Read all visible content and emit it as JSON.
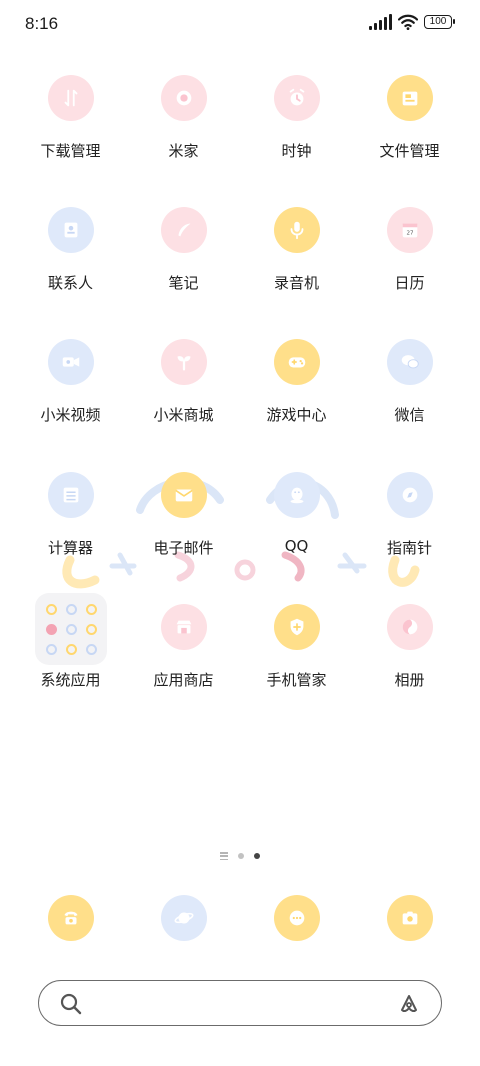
{
  "status_bar": {
    "time": "8:16",
    "battery": "100"
  },
  "apps": [
    {
      "label": "下载管理",
      "icon": "download-arrows-icon",
      "color": "#fde0e4"
    },
    {
      "label": "米家",
      "icon": "mijia-icon",
      "color": "#fde0e4"
    },
    {
      "label": "时钟",
      "icon": "alarm-clock-icon",
      "color": "#fde0e4"
    },
    {
      "label": "文件管理",
      "icon": "file-manager-icon",
      "color": "#ffdf8a"
    },
    {
      "label": "联系人",
      "icon": "contacts-icon",
      "color": "#dfe9fa"
    },
    {
      "label": "笔记",
      "icon": "feather-icon",
      "color": "#fde0e4"
    },
    {
      "label": "录音机",
      "icon": "microphone-icon",
      "color": "#ffdf8a"
    },
    {
      "label": "日历",
      "icon": "calendar-icon",
      "color": "#fde0e4",
      "badge": "27"
    },
    {
      "label": "小米视频",
      "icon": "video-camera-icon",
      "color": "#dfe9fa"
    },
    {
      "label": "小米商城",
      "icon": "sprout-icon",
      "color": "#fde0e4"
    },
    {
      "label": "游戏中心",
      "icon": "gamepad-icon",
      "color": "#ffdf8a"
    },
    {
      "label": "微信",
      "icon": "wechat-icon",
      "color": "#dfe9fa"
    },
    {
      "label": "计算器",
      "icon": "calculator-icon",
      "color": "#dfe9fa"
    },
    {
      "label": "电子邮件",
      "icon": "envelope-icon",
      "color": "#ffdf8a"
    },
    {
      "label": "QQ",
      "icon": "penguin-icon",
      "color": "#dfe9fa"
    },
    {
      "label": "指南针",
      "icon": "compass-icon",
      "color": "#dfe9fa"
    },
    {
      "label": "系统应用",
      "icon": "folder-icon",
      "color": "#f3f3f5"
    },
    {
      "label": "应用商店",
      "icon": "store-icon",
      "color": "#fde0e4"
    },
    {
      "label": "手机管家",
      "icon": "shield-icon",
      "color": "#ffdf8a"
    },
    {
      "label": "相册",
      "icon": "gallery-icon",
      "color": "#fde0e4"
    }
  ],
  "dock": [
    {
      "name": "phone",
      "icon": "telephone-icon",
      "color": "#ffdf8a"
    },
    {
      "name": "browser",
      "icon": "planet-icon",
      "color": "#dfe9fa"
    },
    {
      "name": "messages",
      "icon": "chat-bubble-icon",
      "color": "#ffdf8a"
    },
    {
      "name": "camera",
      "icon": "camera-icon",
      "color": "#ffdf8a"
    }
  ],
  "search": {
    "placeholder": ""
  },
  "page_indicator": {
    "pages": 2,
    "active_index": 1
  }
}
